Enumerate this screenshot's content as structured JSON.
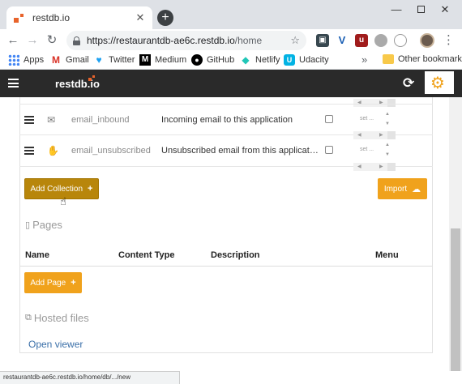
{
  "browser": {
    "tab_title": "restdb.io",
    "tab_close": "✕",
    "new_tab": "+",
    "url_main": "https://restaurantdb-ae6c.restdb.io",
    "url_path": "/home",
    "bookmarks": [
      {
        "label": "Apps"
      },
      {
        "label": "Gmail"
      },
      {
        "label": "Twitter"
      },
      {
        "label": "Medium"
      },
      {
        "label": "GitHub"
      },
      {
        "label": "Netlify"
      },
      {
        "label": "Udacity"
      }
    ],
    "bookmarks_more": "»",
    "other_bookmarks": "Other bookmarks",
    "status_url": "restaurantdb-ae6c.restdb.io/home/db/.../new"
  },
  "app": {
    "logo": "restdb.io"
  },
  "collections": [
    {
      "name": "email_inbound",
      "description": "Incoming email to this application",
      "icon": "envelope-icon",
      "settings": "set ..."
    },
    {
      "name": "email_unsubscribed",
      "description": "Unsubscribed email from this application",
      "icon": "hand-icon",
      "settings": "set ..."
    }
  ],
  "buttons": {
    "add_collection": "Add Collection",
    "import": "Import",
    "add_page": "Add Page"
  },
  "pages": {
    "title": "Pages",
    "columns": [
      "Name",
      "Content Type",
      "Description",
      "Menu"
    ]
  },
  "hosted": {
    "title": "Hosted files",
    "open_viewer": "Open viewer"
  },
  "colors": {
    "accent": "#f0a21c",
    "accent_dark": "#b8860b",
    "header_bg": "#2a2a2a",
    "link": "#3a6fa8"
  }
}
